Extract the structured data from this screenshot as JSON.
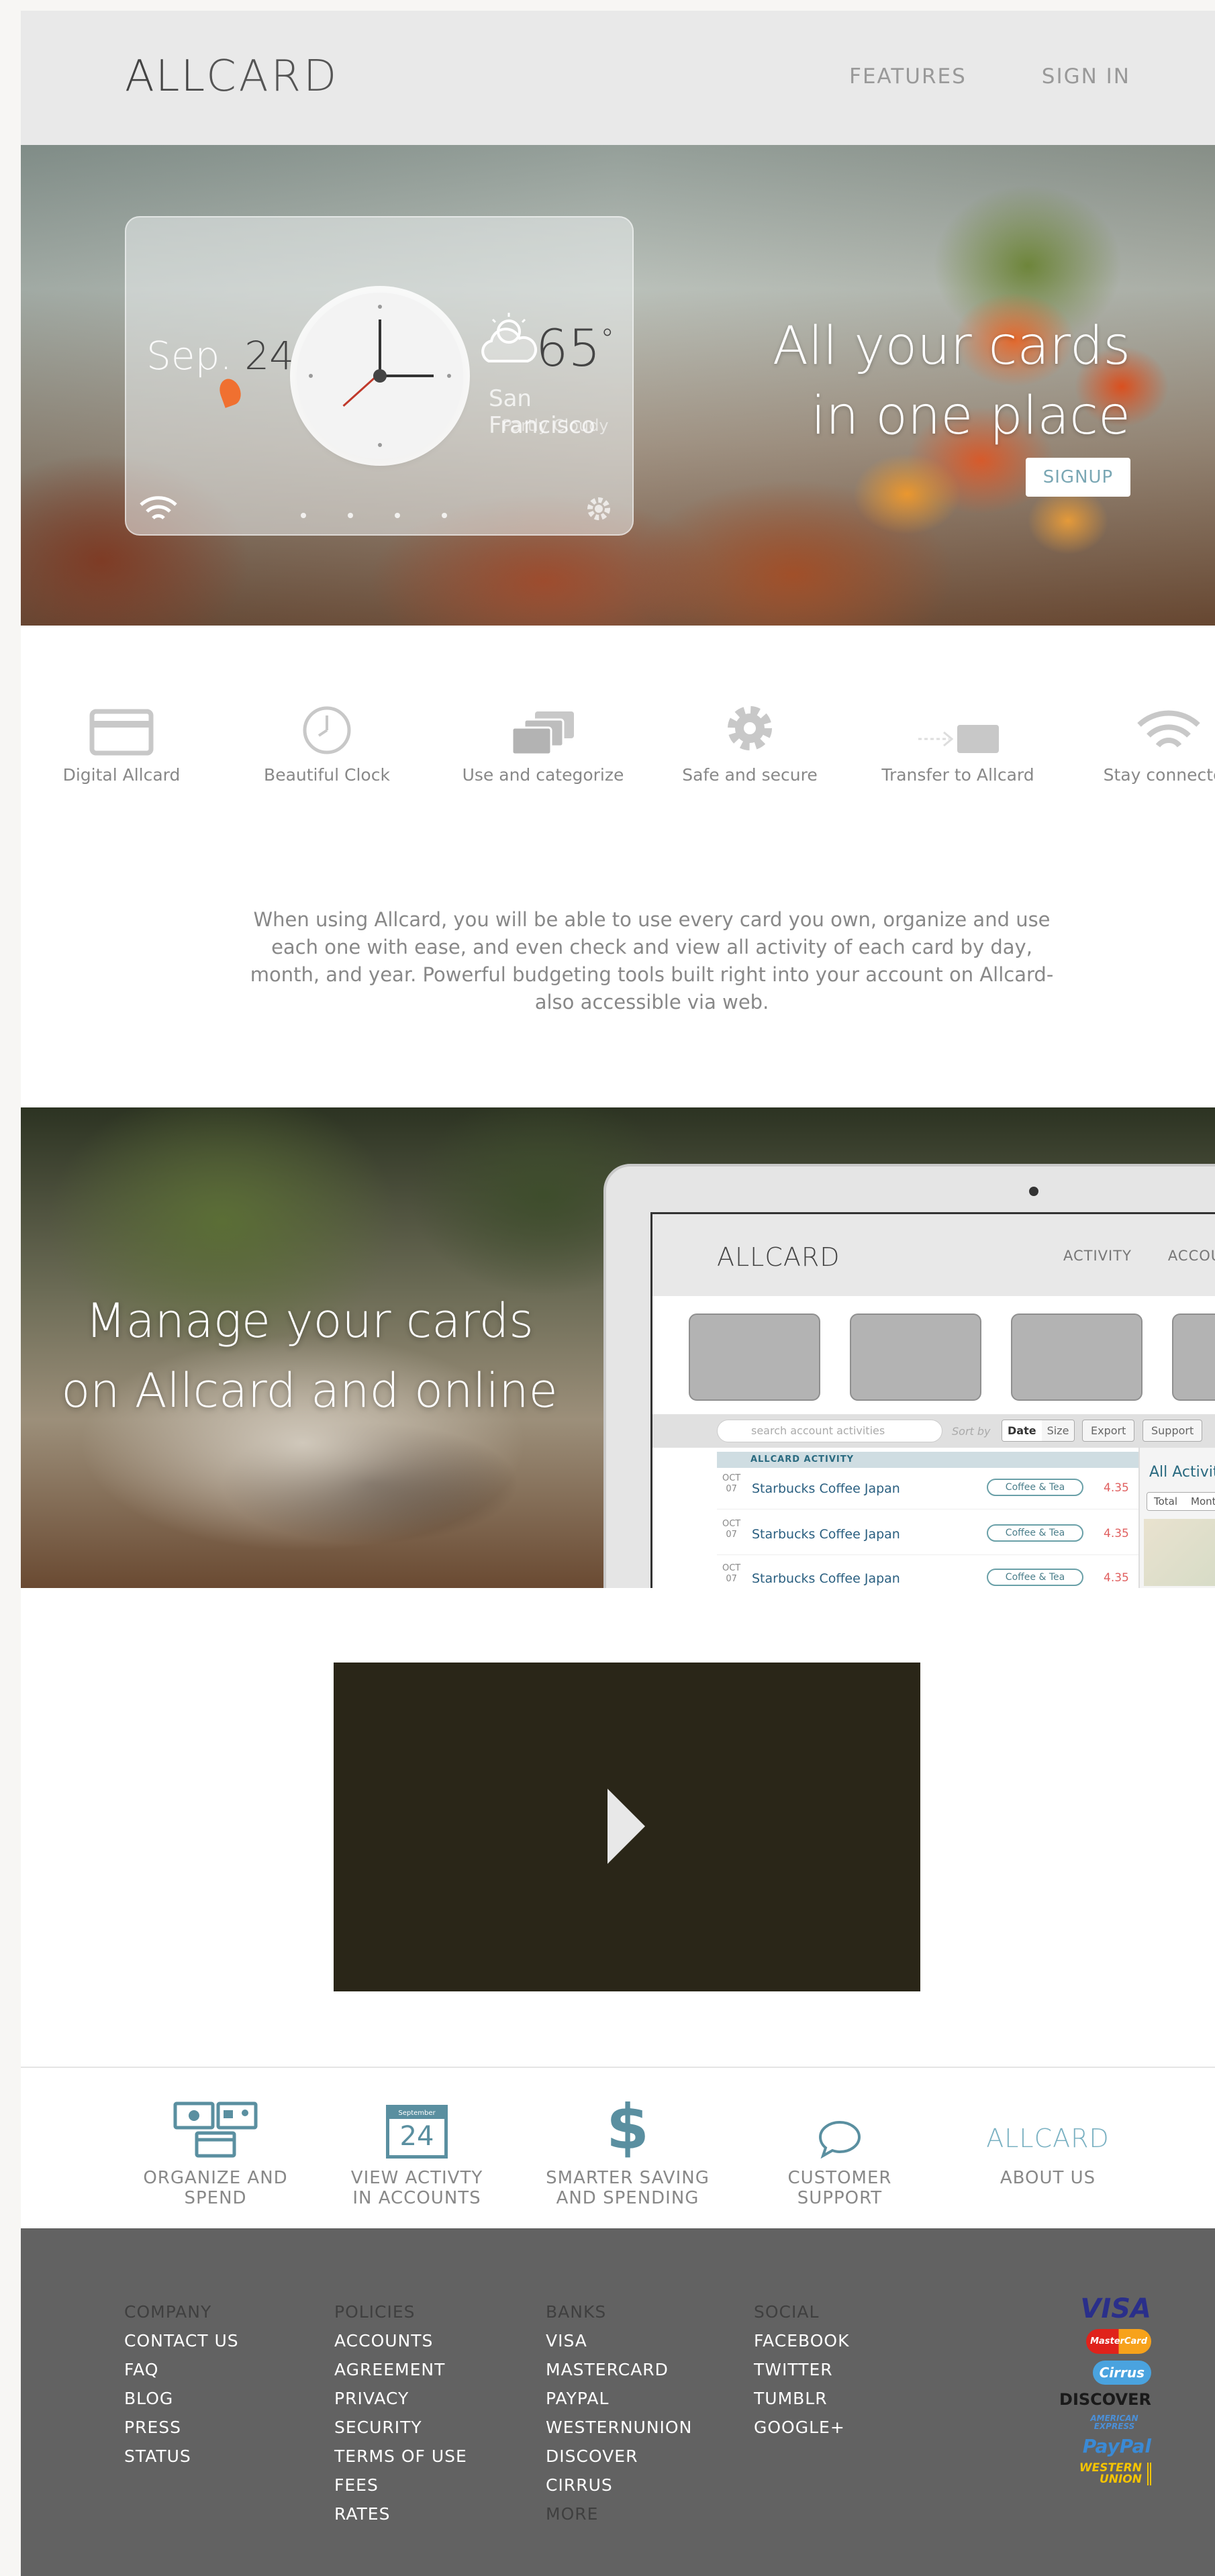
{
  "header": {
    "logo_bold": "ALL",
    "logo_thin": "CARD",
    "nav": [
      "FEATURES",
      "SIGN IN"
    ]
  },
  "hero": {
    "widget": {
      "date_month": "Sep.",
      "date_day": "24",
      "temperature": "65",
      "degree": "°",
      "city": "San Francisco",
      "condition": "Partly Cloudy"
    },
    "title_line1": "All your cards",
    "title_line2": "in one place",
    "signup_label": "SIGNUP"
  },
  "features": [
    {
      "label": "Digital Allcard",
      "icon": "card-icon"
    },
    {
      "label": "Beautiful Clock",
      "icon": "clock-icon"
    },
    {
      "label": "Use and categorize",
      "icon": "cards-stack-icon"
    },
    {
      "label": "Safe and secure",
      "icon": "gear-icon"
    },
    {
      "label": "Transfer to Allcard",
      "icon": "transfer-icon"
    },
    {
      "label": "Stay connected",
      "icon": "wifi-icon"
    }
  ],
  "intro": "When using Allcard, you will be able to use every card you own, organize and use each one with ease, and even check and view all activity of each card by day, month, and year. Powerful budgeting tools built right into your account on Allcard-also accessible via web.",
  "manage": {
    "title_line1": "Manage your cards",
    "title_line2": "on Allcard and online",
    "screen": {
      "logo_bold": "ALL",
      "logo_thin": "CARD",
      "nav": [
        "ACTIVITY",
        "ACCOUNTS"
      ],
      "search_placeholder": "search account activities",
      "sort_label": "Sort by",
      "sort_options": [
        "Date",
        "Size"
      ],
      "export_label": "Export",
      "support_label": "Support",
      "activity_header": "ALLCARD ACTIVITY",
      "rows": [
        {
          "month": "OCT",
          "day": "07",
          "merchant": "Starbucks Coffee Japan",
          "tag": "Coffee & Tea",
          "amount": "4.35"
        },
        {
          "month": "OCT",
          "day": "07",
          "merchant": "Starbucks Coffee Japan",
          "tag": "Coffee & Tea",
          "amount": "4.35"
        },
        {
          "month": "OCT",
          "day": "07",
          "merchant": "Starbucks Coffee Japan",
          "tag": "Coffee & Tea",
          "amount": "4.35"
        }
      ],
      "side_title": "All Activity",
      "side_tabs": [
        "Total",
        "Month"
      ]
    }
  },
  "benefits": [
    {
      "line1": "ORGANIZE AND",
      "line2": "SPEND",
      "icon": "organize-icon"
    },
    {
      "line1": "VIEW ACTIVTY",
      "line2": "IN ACCOUNTS",
      "icon": "calendar-icon",
      "calendar_month": "September 2013",
      "calendar_day": "24"
    },
    {
      "line1": "SMARTER SAVING",
      "line2": "AND SPENDING",
      "icon": "dollar-icon"
    },
    {
      "line1": "CUSTOMER",
      "line2": "SUPPORT",
      "icon": "chat-bubble-icon"
    },
    {
      "line1": "ABOUT US",
      "line2": "",
      "icon": "allcard-logo-icon",
      "logo_bold": "ALL",
      "logo_thin": "CARD"
    }
  ],
  "footer": {
    "columns": [
      {
        "heading": "COMPANY",
        "links": [
          "CONTACT US",
          "FAQ",
          "BLOG",
          "PRESS",
          "STATUS"
        ]
      },
      {
        "heading": "POLICIES",
        "links": [
          "ACCOUNTS",
          "AGREEMENT",
          "PRIVACY",
          "SECURITY",
          "TERMS OF USE",
          "FEES",
          "RATES"
        ]
      },
      {
        "heading": "BANKS",
        "links": [
          "VISA",
          "MASTERCARD",
          "PAYPAL",
          "WESTERNUNION",
          "DISCOVER",
          "CIRRUS"
        ],
        "more": "MORE"
      },
      {
        "heading": "SOCIAL",
        "links": [
          "FACEBOOK",
          "TWITTER",
          "TUMBLR",
          "GOOGLE+"
        ]
      }
    ],
    "payment_logos": [
      "VISA",
      "MasterCard",
      "Cirrus",
      "DISCOVER",
      "AMERICAN EXPRESS",
      "PayPal",
      "WESTERN UNION"
    ]
  },
  "colors": {
    "header_bg": "#e9e9e9",
    "accent_teal": "#5a8fa0",
    "footer_bg": "#626262",
    "video_bg": "#2a2618"
  }
}
